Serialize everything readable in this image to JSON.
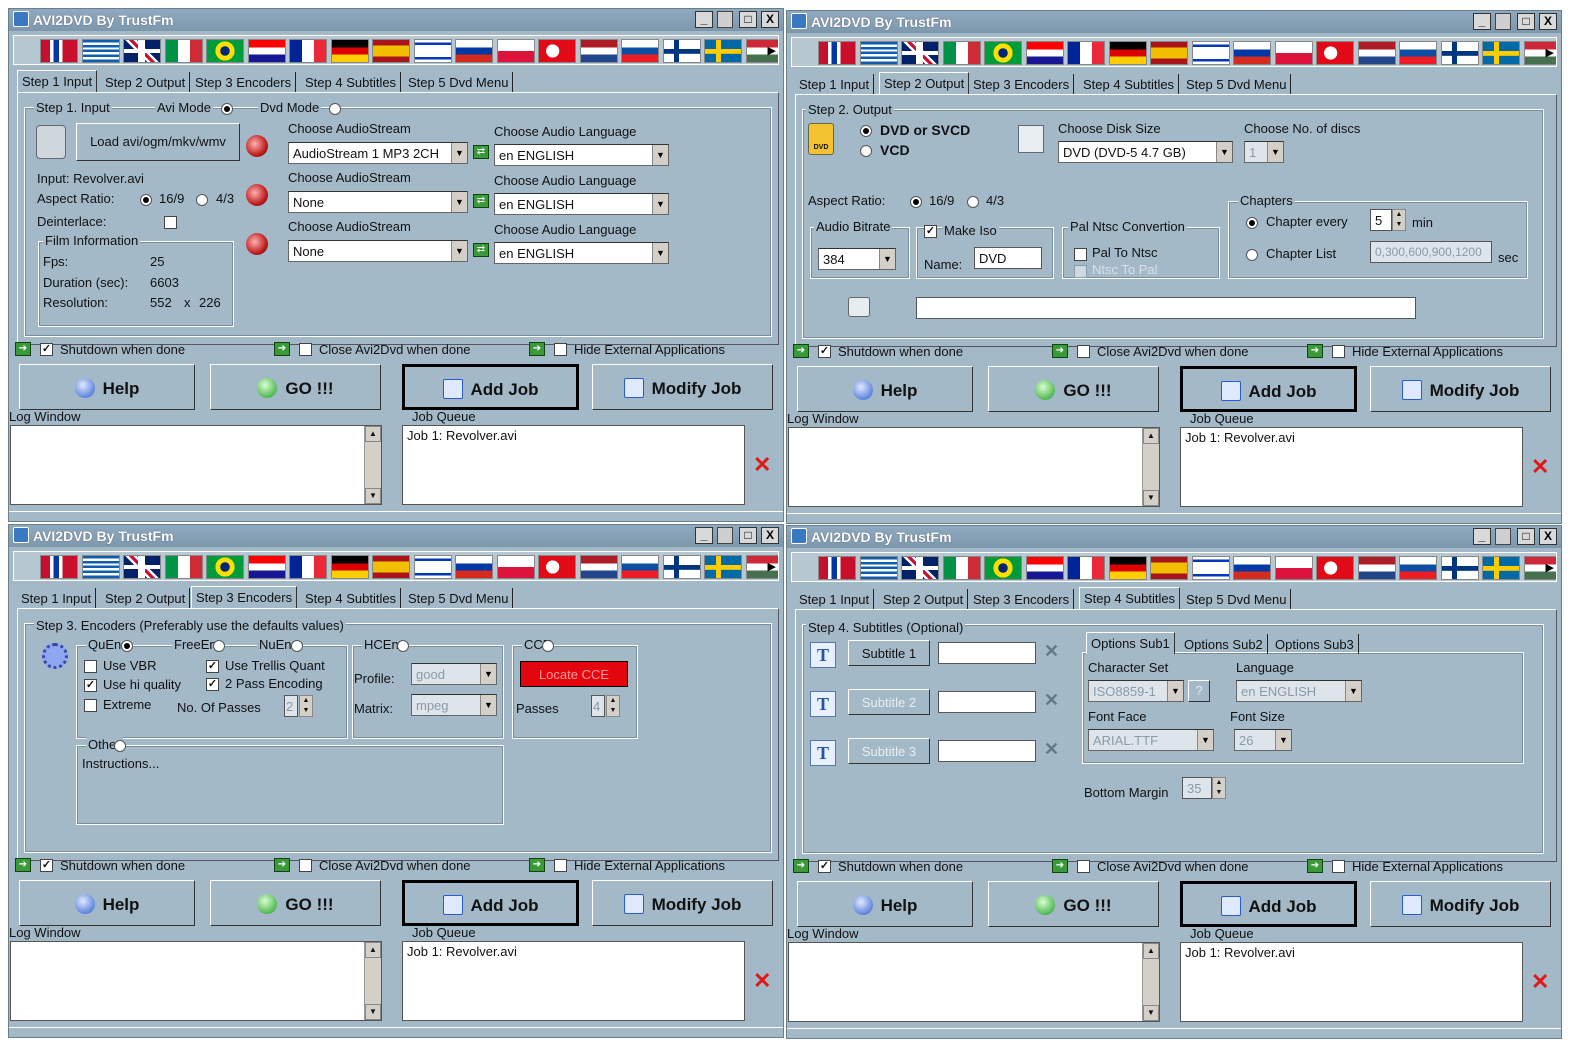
{
  "app_title": "AVI2DVD By TrustFm",
  "window_buttons": {
    "minimize": "_",
    "maximize": "□",
    "close": "X"
  },
  "flags": [
    {
      "name": "dominican-flag"
    },
    {
      "name": "greece-flag"
    },
    {
      "name": "uk-flag"
    },
    {
      "name": "italy-flag"
    },
    {
      "name": "brazil-flag"
    },
    {
      "name": "croatia-flag"
    },
    {
      "name": "france-flag"
    },
    {
      "name": "germany-flag"
    },
    {
      "name": "spain-flag"
    },
    {
      "name": "israel-flag"
    },
    {
      "name": "russia-flag"
    },
    {
      "name": "poland-flag"
    },
    {
      "name": "turkey-flag"
    },
    {
      "name": "netherlands-flag"
    },
    {
      "name": "slovakia-flag"
    },
    {
      "name": "finland-flag"
    },
    {
      "name": "sweden-flag"
    },
    {
      "name": "hungary-flag"
    }
  ],
  "tabs": [
    "Step 1 Input",
    "Step 2 Output",
    "Step 3 Encoders",
    "Step 4 Subtitles",
    "Step 5 Dvd Menu"
  ],
  "bottom": {
    "shutdown": "Shutdown when done",
    "close_app": "Close Avi2Dvd when done",
    "hide_ext": "Hide External Applications",
    "help": "Help",
    "go": "GO !!!",
    "add_job": "Add Job",
    "modify_job": "Modify Job",
    "log_window": "Log Window",
    "job_queue": "Job Queue",
    "job_item": "Job 1: Revolver.avi",
    "delete_glyph": "✕"
  },
  "step1": {
    "group": "Step 1. Input",
    "avi_mode": "Avi Mode",
    "dvd_mode": "Dvd Mode",
    "load_button": "Load avi/ogm/mkv/wmv",
    "input": "Input: Revolver.avi",
    "aspect": "Aspect Ratio:",
    "r169": "16/9",
    "r43": "4/3",
    "deinterlace": "Deinterlace:",
    "film_info": "Film Information",
    "fps_label": "Fps:",
    "fps": "25",
    "duration_label": "Duration (sec):",
    "duration": "6603",
    "resolution_label": "Resolution:",
    "res_w": "552",
    "res_x": "x",
    "res_h": "226",
    "choose_stream": "Choose AudioStream",
    "choose_lang": "Choose Audio Language",
    "stream1": "AudioStream 1 MP3 2CH",
    "stream2": "None",
    "stream3": "None",
    "lang1": "en ENGLISH",
    "lang2": "en ENGLISH",
    "lang3": "en ENGLISH"
  },
  "step2": {
    "group": "Step 2. Output",
    "dvd_or_svcd": "DVD or SVCD",
    "vcd": "VCD",
    "disk_size_label": "Choose Disk Size",
    "disk_size": "DVD (DVD-5 4.7 GB)",
    "discs_label": "Choose No. of discs",
    "discs": "1",
    "aspect": "Aspect Ratio:",
    "r169": "16/9",
    "r43": "4/3",
    "chapters": "Chapters",
    "chapter_every": "Chapter every",
    "chapter_every_val": "5",
    "min": "min",
    "chapter_list": "Chapter List",
    "chapter_list_val": "0,300,600,900,1200",
    "sec": "sec",
    "audio_bitrate": "Audio Bitrate",
    "bitrate": "384",
    "make_iso": "Make Iso",
    "name_label": "Name:",
    "name_val": "DVD",
    "pal_ntsc": "Pal Ntsc Convertion",
    "pal_to_ntsc": "Pal To Ntsc",
    "ntsc_to_pal": "Ntsc To Pal",
    "path_val": ""
  },
  "step3": {
    "group": "Step 3. Encoders (Preferably use the defaults values)",
    "quenc": "QuEnc",
    "freeenc": "FreeEnc",
    "nuenc": "NuEnc",
    "hcenc": "HCEnc",
    "cce": "CCE",
    "use_vbr": "Use VBR",
    "use_hi": "Use hi quality",
    "extreme": "Extreme",
    "trellis": "Use Trellis Quant",
    "two_pass": "2 Pass Encoding",
    "no_passes": "No. Of Passes",
    "passes_val": "2",
    "profile_label": "Profile:",
    "profile": "good",
    "matrix_label": "Matrix:",
    "matrix": "mpeg",
    "locate_cce": "Locate CCE",
    "passes_label": "Passes",
    "cce_passes": "4",
    "other": "Other",
    "instructions": "Instructions..."
  },
  "step4": {
    "group": "Step 4. Subtitles (Optional)",
    "sub1": "Subtitle 1",
    "sub2": "Subtitle 2",
    "sub3": "Subtitle 3",
    "opt1": "Options Sub1",
    "opt2": "Options Sub2",
    "opt3": "Options Sub3",
    "charset_label": "Character Set",
    "charset": "ISO8859-1",
    "q": "?",
    "language_label": "Language",
    "language": "en ENGLISH",
    "fontface_label": "Font Face",
    "fontface": "ARIAL.TTF",
    "fontsize_label": "Font Size",
    "fontsize": "26",
    "bottom_margin_label": "Bottom Margin",
    "bottom_margin": "35",
    "remove": "✕"
  }
}
